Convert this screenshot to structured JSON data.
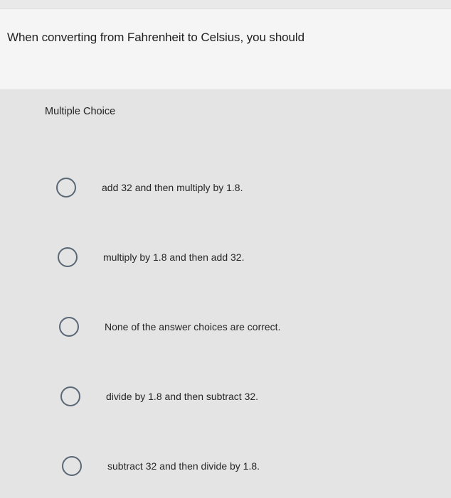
{
  "question": {
    "text": "When converting from Fahrenheit to Celsius, you should"
  },
  "answer_panel": {
    "type_label": "Multiple Choice",
    "choices": [
      {
        "label": "add 32 and then multiply by 1.8."
      },
      {
        "label": "multiply by 1.8 and then add 32."
      },
      {
        "label": "None of the answer choices are correct."
      },
      {
        "label": "divide by 1.8 and then subtract 32."
      },
      {
        "label": "subtract 32 and then divide by 1.8."
      }
    ]
  },
  "colors": {
    "radio_border": "#5a6775",
    "panel_background": "#e4e4e4",
    "page_background": "#f5f5f5"
  },
  "icons": [
    "radio-circle-icon"
  ]
}
